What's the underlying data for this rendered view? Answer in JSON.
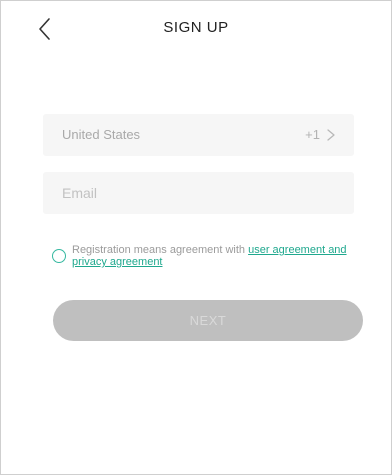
{
  "header": {
    "title": "SIGN UP",
    "back_icon": "chevron-left-icon"
  },
  "form": {
    "country_name": "United States",
    "country_code": "+1",
    "country_chevron_icon": "chevron-right-icon",
    "email_placeholder": "Email",
    "email_value": ""
  },
  "agreement": {
    "prefix": "Registration means agreement with ",
    "link_text": "user agreement and privacy agreement",
    "checked": false
  },
  "actions": {
    "next_label": "NEXT"
  },
  "colors": {
    "accent": "#1fa88e",
    "button_disabled": "#bfbfbf",
    "field_background": "#f6f6f6"
  }
}
